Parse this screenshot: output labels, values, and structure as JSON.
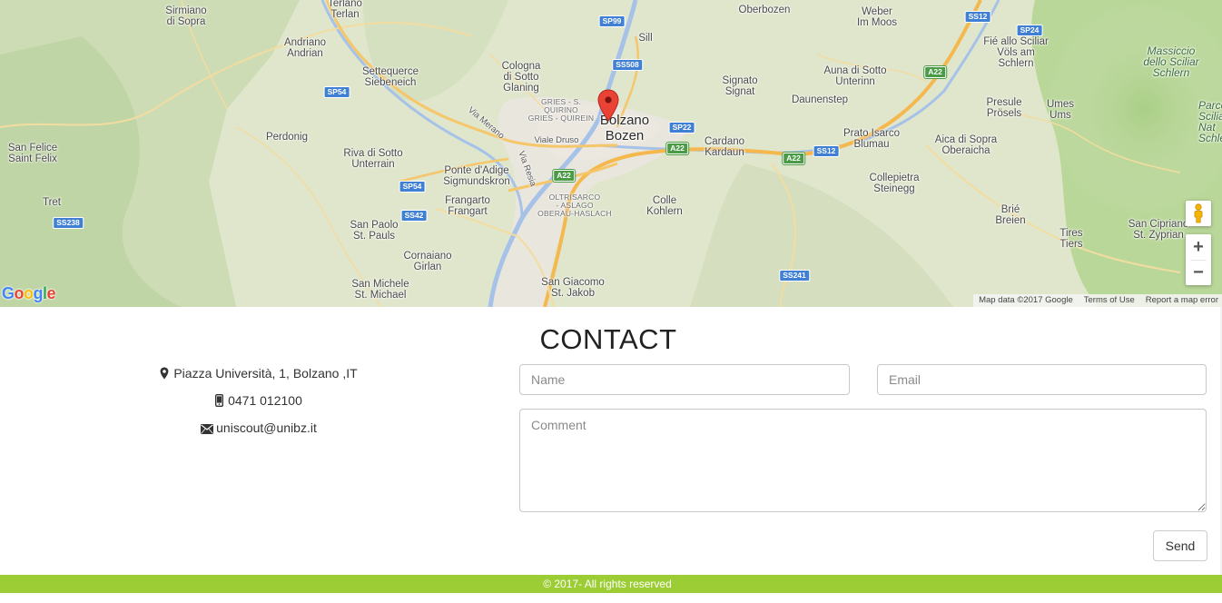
{
  "map": {
    "labels": [
      {
        "text": "Sirmiano\ndi Sopra"
      },
      {
        "text": "Terlano\nTerlan"
      },
      {
        "text": "Andriano\nAndrian"
      },
      {
        "text": "Settequerce\nSiebeneich"
      },
      {
        "text": "Cologna\ndi Sotto\nGlaning"
      },
      {
        "text": "Sill"
      },
      {
        "text": "Oberbozen"
      },
      {
        "text": "Weber\nIm Moos"
      },
      {
        "text": "Fié allo Sciliar\nVöls am\nSchlern"
      },
      {
        "text": "Signato\nSignat"
      },
      {
        "text": "Auna di Sotto\nUnterinn"
      },
      {
        "text": "Daunenstep"
      },
      {
        "text": "Presule\nPrösels"
      },
      {
        "text": "Umes\nUms"
      },
      {
        "text": "San Felice\nSaint Felix"
      },
      {
        "text": "Perdonig"
      },
      {
        "text": "Riva di Sotto\nUnterrain"
      },
      {
        "text": "Ponte d'Adige\nSigmundskron"
      },
      {
        "text": "Frangarto\nFrangart"
      },
      {
        "text": "Cardano\nKardaun"
      },
      {
        "text": "Prato Isarco\nBlumau"
      },
      {
        "text": "Aica di Sopra\nOberaicha"
      },
      {
        "text": "Collepietra\nSteinegg"
      },
      {
        "text": "Tret"
      },
      {
        "text": "Colle\nKohlern"
      },
      {
        "text": "San Paolo\nSt. Pauls"
      },
      {
        "text": "Cornaiano\nGirlan"
      },
      {
        "text": "Brié\nBreien"
      },
      {
        "text": "Tires\nTiers"
      },
      {
        "text": "San Cipriano\nSt. Zyprian"
      },
      {
        "text": "San Michele\nSt. Michael"
      },
      {
        "text": "San Giacomo\nSt. Jakob"
      }
    ],
    "small_labels": [
      {
        "text": "GRIES - S.\nQUIRINO\nGRIES - QUIREIN"
      },
      {
        "text": "OLTRISARCO\n- ASLAGO\nOBERAU-HASLACH"
      },
      {
        "text": "Via Merano"
      },
      {
        "text": "Viale Druso"
      },
      {
        "text": "Via Resia"
      }
    ],
    "park_label": "Massiccio\ndello Sciliar\nSchlern",
    "park_label_2": "Parco\nSciliar-\nNat\nSchlern-P",
    "city_label": "Bolzano\nBozen",
    "shields": [
      {
        "text": "SP99",
        "type": "blue"
      },
      {
        "text": "SS508",
        "type": "blue"
      },
      {
        "text": "SP54",
        "type": "blue"
      },
      {
        "text": "SP22",
        "type": "blue"
      },
      {
        "text": "SS12",
        "type": "blue"
      },
      {
        "text": "SS12",
        "type": "blue"
      },
      {
        "text": "SP24",
        "type": "blue"
      },
      {
        "text": "A22",
        "type": "green"
      },
      {
        "text": "A22",
        "type": "green"
      },
      {
        "text": "A22",
        "type": "green"
      },
      {
        "text": "A22",
        "type": "green"
      },
      {
        "text": "SP54",
        "type": "blue"
      },
      {
        "text": "SS42",
        "type": "blue"
      },
      {
        "text": "SS238",
        "type": "blue"
      },
      {
        "text": "SS241",
        "type": "blue"
      }
    ],
    "logo": "Google",
    "attribution": {
      "map_data": "Map data ©2017 Google",
      "terms": "Terms of Use",
      "report": "Report a map error"
    },
    "zoom_in": "+",
    "zoom_out": "−"
  },
  "contact": {
    "title": "CONTACT",
    "address": "Piazza Università, 1, Bolzano ,IT",
    "phone": "0471 012100",
    "email": "uniscout@unibz.it",
    "form": {
      "name_placeholder": "Name",
      "email_placeholder": "Email",
      "comment_placeholder": "Comment",
      "send_label": "Send"
    }
  },
  "footer": {
    "text": "© 2017- All rights reserved"
  },
  "colors": {
    "footer_bg": "#9ccd35",
    "map_pin": "#ea4335",
    "shield_blue": "#3f7fd4",
    "shield_green": "#4a9a46"
  }
}
